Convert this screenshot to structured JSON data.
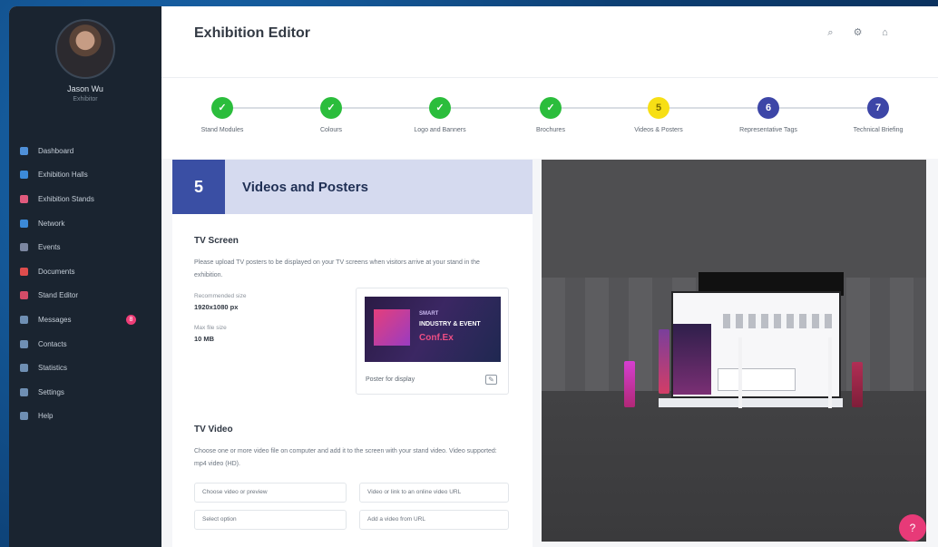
{
  "app": {
    "title": "Exhibition Editor"
  },
  "user": {
    "name": "Jason Wu",
    "role": "Exhibitor"
  },
  "sidebar": {
    "items": [
      {
        "label": "Dashboard",
        "icon": "dashboard-icon"
      },
      {
        "label": "Exhibition Halls",
        "icon": "hall-icon"
      },
      {
        "label": "Exhibition Stands",
        "icon": "stand-icon"
      },
      {
        "label": "Network",
        "icon": "network-icon"
      },
      {
        "label": "Events",
        "icon": "calendar-icon"
      },
      {
        "label": "Documents",
        "icon": "document-icon"
      },
      {
        "label": "Stand Editor",
        "icon": "editor-icon"
      },
      {
        "label": "Messages",
        "icon": "message-icon",
        "badge": "8"
      },
      {
        "label": "Contacts",
        "icon": "contacts-icon"
      },
      {
        "label": "Statistics",
        "icon": "stats-icon"
      },
      {
        "label": "Settings",
        "icon": "gear-icon"
      },
      {
        "label": "Help",
        "icon": "help-icon"
      }
    ]
  },
  "topbar": {
    "icons": [
      "search-icon",
      "gear-icon",
      "bell-icon"
    ]
  },
  "stepper": {
    "steps": [
      {
        "num": "✓",
        "label": "Stand Modules",
        "status": "done",
        "color": "#2bbd3c"
      },
      {
        "num": "✓",
        "label": "Colours",
        "status": "done",
        "color": "#2bbd3c"
      },
      {
        "num": "✓",
        "label": "Logo and Banners",
        "status": "done",
        "color": "#2bbd3c"
      },
      {
        "num": "✓",
        "label": "Brochures",
        "status": "done",
        "color": "#2bbd3c"
      },
      {
        "num": "5",
        "label": "Videos & Posters",
        "status": "active",
        "color": "#f7df15"
      },
      {
        "num": "6",
        "label": "Representative Tags",
        "status": "todo",
        "color": "#3d46a7"
      },
      {
        "num": "7",
        "label": "Technical Briefing",
        "status": "todo",
        "color": "#3d46a7"
      }
    ]
  },
  "section": {
    "number": "5",
    "title": "Videos and Posters",
    "tv_screen": {
      "title": "TV Screen",
      "description": "Please upload TV posters to be displayed on your TV screens when visitors arrive at your stand in the exhibition.",
      "dimensions_label": "Recommended size",
      "dimensions_value": "1920x1080 px",
      "size_label": "Max file size",
      "size_value": "10 MB",
      "poster": {
        "line1": "SMART",
        "line2": "INDUSTRY & EVENT",
        "line3": "Conf.Ex",
        "caption": "Poster for display"
      }
    },
    "tv_video": {
      "title": "TV Video",
      "description": "Choose one or more video file on computer and add it to the screen with your stand video. Video supported: mp4 video (HD).",
      "select_left": "Choose video or preview",
      "select_right": "Video or link to an online video URL",
      "select_left_2": "Select option",
      "select_right_2": "Add a video from URL"
    }
  },
  "fab": {
    "label": "?"
  }
}
